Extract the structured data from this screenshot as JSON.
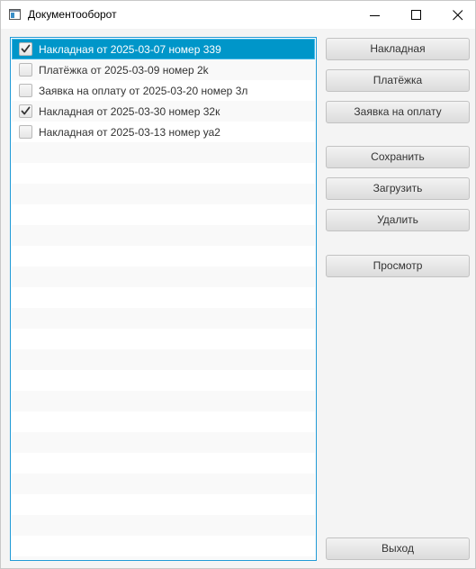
{
  "window": {
    "title": "Документооборот",
    "app_icon": "window-app-icon",
    "controls": {
      "minimize_icon": "minimize-icon",
      "maximize_icon": "maximize-icon",
      "close_icon": "close-icon"
    }
  },
  "list": {
    "items": [
      {
        "label": "Накладная от 2025-03-07 номер 339",
        "checked": true,
        "selected": true
      },
      {
        "label": "Платёжка от 2025-03-09 номер 2k",
        "checked": false,
        "selected": false
      },
      {
        "label": "Заявка на оплату от 2025-03-20 номер 3л",
        "checked": false,
        "selected": false
      },
      {
        "label": "Накладная от 2025-03-30 номер 32к",
        "checked": true,
        "selected": false
      },
      {
        "label": "Накладная от 2025-03-13 номер уа2",
        "checked": false,
        "selected": false
      }
    ]
  },
  "buttons": {
    "invoice": "Накладная",
    "payment": "Платёжка",
    "payment_request": "Заявка на оплату",
    "save": "Сохранить",
    "load": "Загрузить",
    "delete": "Удалить",
    "view": "Просмотр",
    "exit": "Выход"
  },
  "colors": {
    "selection": "#0096c9",
    "list_border": "#1f9ad6"
  }
}
